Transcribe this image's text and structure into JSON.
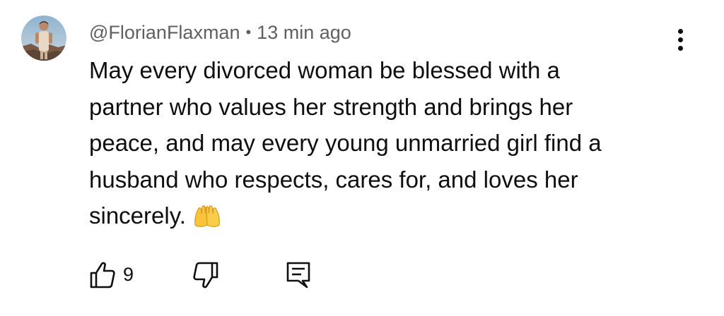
{
  "comment": {
    "author": "@FlorianFlaxman",
    "separator": "•",
    "time": "13 min ago",
    "lines": [
      "May every divorced woman be blessed with a",
      "partner who values her strength and brings her",
      "peace, and may every young unmarried girl find a",
      "husband who respects, cares for, and loves her",
      "sincerely."
    ],
    "emoji_icon": "palms-up-together-icon",
    "like_count": "9"
  },
  "icons": {
    "like": "thumb-up-icon",
    "dislike": "thumb-down-icon",
    "reply": "comment-reply-icon",
    "menu": "more-vertical-icon"
  },
  "colors": {
    "text": "#0f0f0f",
    "meta": "#606060",
    "emoji": "#f7c43b"
  }
}
